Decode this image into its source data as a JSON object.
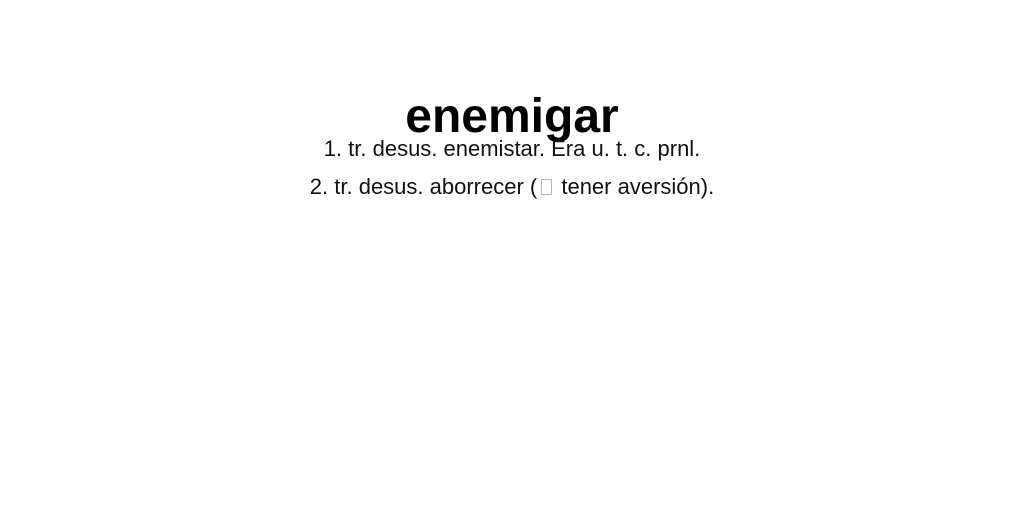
{
  "entry": {
    "headword": "enemigar",
    "definitions": [
      {
        "text": "1. tr. desus. enemistar. Era u. t. c. prnl."
      },
      {
        "before_glyph": "2. tr. desus. aborrecer (",
        "glyph_icon": "missing-glyph-icon",
        "after_glyph": " tener aversión)."
      }
    ]
  }
}
